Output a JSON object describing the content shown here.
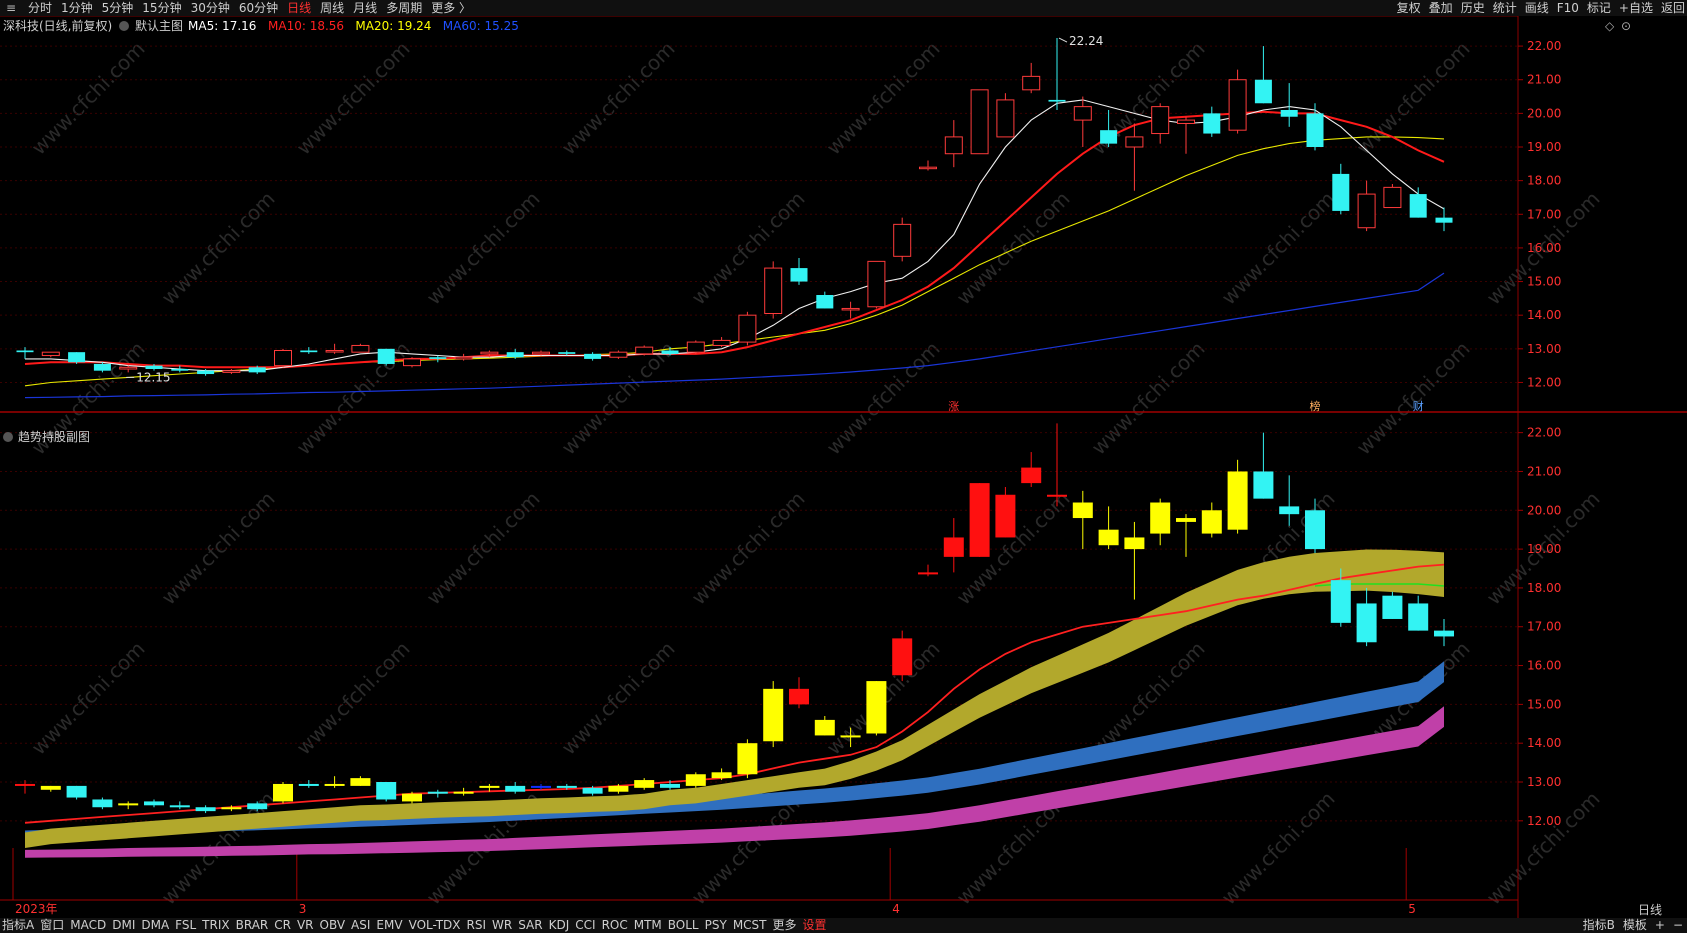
{
  "toolbar": {
    "left_items": [
      "分时",
      "1分钟",
      "5分钟",
      "15分钟",
      "30分钟",
      "60分钟",
      "日线",
      "周线",
      "月线",
      "多周期",
      "更多 〉"
    ],
    "active_item": "日线",
    "right_items": [
      "复权",
      "叠加",
      "历史",
      "统计",
      "画线",
      "F10",
      "标记",
      "+自选",
      "返回"
    ]
  },
  "main_panel": {
    "title": "深科技(日线,前复权)",
    "template": "默认主图",
    "ma_labels": [
      {
        "text": "MA5: 17.16",
        "color": "#ffffff"
      },
      {
        "text": "MA10: 18.56",
        "color": "#ff2020"
      },
      {
        "text": "MA20: 19.24",
        "color": "#ffff00"
      },
      {
        "text": "MA60: 15.25",
        "color": "#2050ff"
      }
    ],
    "y_ticks": [
      "22.00",
      "21.00",
      "20.00",
      "19.00",
      "18.00",
      "17.00",
      "16.00",
      "15.00",
      "14.00",
      "13.00",
      "12.00"
    ],
    "high_label": "22.24",
    "low_label": "12.15",
    "markers": [
      "涨",
      "榜",
      "财"
    ]
  },
  "sub_panel": {
    "title": "趋势持股副图",
    "y_ticks": [
      "22.00",
      "21.00",
      "20.00",
      "19.00",
      "18.00",
      "17.00",
      "16.00",
      "15.00",
      "14.00",
      "13.00",
      "12.00"
    ],
    "x_labels": [
      "2023年",
      "3",
      "4",
      "5"
    ]
  },
  "watermark": "www.cfchi.com",
  "axis_corner_label": "日线",
  "bottombar": {
    "items": [
      "指标A",
      "窗口",
      "MACD",
      "DMI",
      "DMA",
      "FSL",
      "TRIX",
      "BRAR",
      "CR",
      "VR",
      "OBV",
      "ASI",
      "EMV",
      "VOL-TDX",
      "RSI",
      "WR",
      "SAR",
      "KDJ",
      "CCI",
      "ROC",
      "MTM",
      "BOLL",
      "PSY",
      "MCST",
      "更多",
      "设置"
    ],
    "selected": "设置",
    "right_items": [
      "指标B",
      "模板",
      "+",
      "−"
    ]
  },
  "chart_data": {
    "type": "candlestick",
    "note": "daily OHLC, forward adjusted",
    "candles": [
      [
        12.95,
        12.9,
        13.05,
        12.7
      ],
      [
        12.8,
        12.9,
        12.9,
        12.75
      ],
      [
        12.9,
        12.6,
        12.9,
        12.55
      ],
      [
        12.55,
        12.35,
        12.6,
        12.3
      ],
      [
        12.4,
        12.45,
        12.5,
        12.3
      ],
      [
        12.5,
        12.4,
        12.55,
        12.35
      ],
      [
        12.4,
        12.35,
        12.5,
        12.3
      ],
      [
        12.35,
        12.25,
        12.4,
        12.2
      ],
      [
        12.3,
        12.35,
        12.4,
        12.25
      ],
      [
        12.45,
        12.3,
        12.5,
        12.25
      ],
      [
        12.5,
        12.95,
        13.0,
        12.45
      ],
      [
        12.95,
        12.9,
        13.05,
        12.85
      ],
      [
        12.95,
        12.95,
        13.15,
        12.85
      ],
      [
        12.9,
        13.1,
        13.15,
        12.9
      ],
      [
        13.0,
        12.55,
        13.0,
        12.5
      ],
      [
        12.5,
        12.7,
        12.75,
        12.45
      ],
      [
        12.75,
        12.7,
        12.8,
        12.6
      ],
      [
        12.7,
        12.75,
        12.85,
        12.65
      ],
      [
        12.85,
        12.9,
        12.95,
        12.75
      ],
      [
        12.9,
        12.75,
        13.0,
        12.7
      ],
      [
        12.85,
        12.9,
        12.95,
        12.8
      ],
      [
        12.9,
        12.85,
        12.95,
        12.8
      ],
      [
        12.85,
        12.7,
        12.9,
        12.65
      ],
      [
        12.75,
        12.9,
        12.95,
        12.7
      ],
      [
        12.85,
        13.05,
        13.1,
        12.8
      ],
      [
        12.95,
        12.85,
        13.05,
        12.8
      ],
      [
        12.9,
        13.2,
        13.25,
        12.85
      ],
      [
        13.1,
        13.25,
        13.35,
        13.05
      ],
      [
        13.2,
        14.0,
        14.1,
        13.1
      ],
      [
        14.05,
        15.4,
        15.6,
        13.9
      ],
      [
        15.4,
        15.0,
        15.7,
        14.9
      ],
      [
        14.6,
        14.2,
        14.7,
        14.2
      ],
      [
        14.2,
        14.2,
        14.4,
        13.9
      ],
      [
        14.25,
        15.6,
        15.6,
        14.2
      ],
      [
        15.75,
        16.7,
        16.9,
        15.6
      ],
      [
        18.4,
        18.4,
        18.6,
        18.3
      ],
      [
        18.8,
        19.3,
        19.8,
        18.4
      ],
      [
        18.8,
        20.7,
        20.7,
        18.8
      ],
      [
        19.3,
        20.4,
        20.6,
        19.3
      ],
      [
        20.7,
        21.1,
        21.5,
        20.6
      ],
      [
        20.4,
        20.35,
        22.24,
        20.1
      ],
      [
        19.8,
        20.2,
        20.5,
        19.0
      ],
      [
        19.5,
        19.1,
        20.1,
        19.0
      ],
      [
        19.0,
        19.3,
        19.7,
        17.7
      ],
      [
        19.4,
        20.2,
        20.3,
        19.1
      ],
      [
        19.7,
        19.8,
        19.9,
        18.8
      ],
      [
        20.0,
        19.4,
        20.2,
        19.3
      ],
      [
        19.5,
        21.0,
        21.3,
        19.4
      ],
      [
        21.0,
        20.3,
        22.0,
        20.3
      ],
      [
        20.1,
        19.9,
        20.9,
        19.6
      ],
      [
        20.0,
        19.0,
        20.3,
        18.9
      ],
      [
        18.2,
        17.1,
        18.5,
        17.0
      ],
      [
        16.6,
        17.6,
        18.0,
        16.5
      ],
      [
        17.2,
        17.8,
        17.9,
        17.2
      ],
      [
        17.6,
        16.9,
        17.8,
        16.9
      ],
      [
        16.9,
        16.75,
        17.2,
        16.5
      ]
    ],
    "ma5": [
      12.7,
      12.7,
      12.65,
      12.6,
      12.5,
      12.45,
      12.4,
      12.35,
      12.35,
      12.35,
      12.45,
      12.55,
      12.7,
      12.85,
      12.9,
      12.85,
      12.8,
      12.75,
      12.75,
      12.8,
      12.8,
      12.8,
      12.8,
      12.8,
      12.85,
      12.85,
      12.9,
      13.0,
      13.3,
      13.7,
      14.2,
      14.5,
      14.7,
      14.95,
      15.1,
      15.6,
      16.4,
      17.9,
      19.0,
      19.8,
      20.3,
      20.4,
      20.2,
      20.0,
      19.8,
      19.7,
      19.75,
      19.9,
      20.1,
      20.2,
      20.1,
      19.6,
      18.9,
      18.2,
      17.6,
      17.16
    ],
    "ma10": [
      12.55,
      12.6,
      12.6,
      12.6,
      12.55,
      12.5,
      12.5,
      12.45,
      12.45,
      12.45,
      12.45,
      12.5,
      12.55,
      12.6,
      12.65,
      12.7,
      12.7,
      12.75,
      12.8,
      12.8,
      12.8,
      12.8,
      12.8,
      12.8,
      12.85,
      12.85,
      12.85,
      12.9,
      13.05,
      13.25,
      13.45,
      13.65,
      13.85,
      14.15,
      14.45,
      14.85,
      15.4,
      16.1,
      16.8,
      17.5,
      18.2,
      18.8,
      19.3,
      19.65,
      19.85,
      19.9,
      19.95,
      20.0,
      20.05,
      20.0,
      20.0,
      19.8,
      19.6,
      19.3,
      18.9,
      18.56
    ],
    "ma20": [
      11.9,
      12.0,
      12.05,
      12.1,
      12.15,
      12.2,
      12.25,
      12.3,
      12.35,
      12.4,
      12.45,
      12.5,
      12.55,
      12.6,
      12.62,
      12.65,
      12.68,
      12.7,
      12.72,
      12.75,
      12.78,
      12.8,
      12.83,
      12.85,
      12.9,
      13.0,
      13.05,
      13.15,
      13.25,
      13.35,
      13.45,
      13.55,
      13.75,
      14.0,
      14.3,
      14.7,
      15.1,
      15.5,
      15.85,
      16.2,
      16.5,
      16.8,
      17.1,
      17.45,
      17.8,
      18.15,
      18.45,
      18.75,
      18.95,
      19.1,
      19.2,
      19.25,
      19.3,
      19.3,
      19.28,
      19.24
    ],
    "ma60": [
      11.55,
      11.56,
      11.57,
      11.58,
      11.6,
      11.61,
      11.62,
      11.63,
      11.65,
      11.66,
      11.68,
      11.7,
      11.71,
      11.73,
      11.75,
      11.77,
      11.79,
      11.81,
      11.83,
      11.86,
      11.89,
      11.92,
      11.95,
      11.98,
      12.01,
      12.04,
      12.07,
      12.1,
      12.14,
      12.18,
      12.22,
      12.26,
      12.31,
      12.37,
      12.43,
      12.5,
      12.6,
      12.7,
      12.82,
      12.94,
      13.06,
      13.18,
      13.3,
      13.42,
      13.54,
      13.66,
      13.78,
      13.9,
      14.02,
      14.14,
      14.26,
      14.38,
      14.5,
      14.62,
      14.74,
      15.25
    ],
    "sub_red_line": [
      11.95,
      12.0,
      12.05,
      12.1,
      12.15,
      12.2,
      12.25,
      12.3,
      12.35,
      12.4,
      12.45,
      12.5,
      12.55,
      12.6,
      12.65,
      12.7,
      12.72,
      12.74,
      12.76,
      12.78,
      12.8,
      12.82,
      12.85,
      12.9,
      12.95,
      13.0,
      13.05,
      13.1,
      13.2,
      13.35,
      13.5,
      13.6,
      13.7,
      13.9,
      14.3,
      14.8,
      15.4,
      15.9,
      16.3,
      16.6,
      16.8,
      17.0,
      17.1,
      17.2,
      17.3,
      17.4,
      17.55,
      17.7,
      17.8,
      17.95,
      18.1,
      18.25,
      18.35,
      18.45,
      18.55,
      18.6
    ],
    "y_min": 11.3,
    "y_max": 22.3,
    "x_labels": [
      "2023年",
      "3",
      "4",
      "5"
    ]
  }
}
